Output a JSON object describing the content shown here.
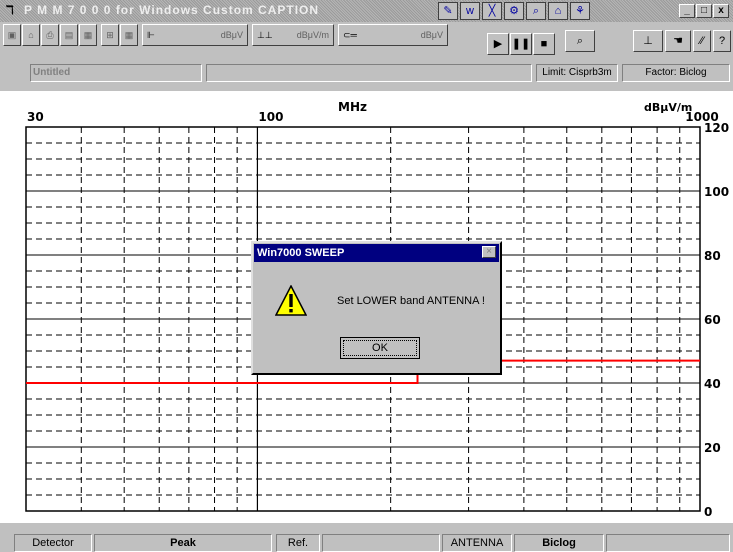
{
  "window": {
    "app_icon": "ℸ",
    "title": "P M M   7 0 0 0  for  Windows  Custom CAPTION",
    "controls": {
      "minimize": "_",
      "maximize": "□",
      "close": "x"
    }
  },
  "toolbar": {
    "units_a": "dBμV",
    "units_b": "dBμV/m",
    "units_c": "dBμV"
  },
  "status_top": {
    "file": "Untitled",
    "limit": "Limit: Cisprb3m",
    "factor": "Factor: Biclog"
  },
  "plot": {
    "x_unit": "MHz",
    "y_unit": "dBμV/m",
    "x_ticks": [
      "30",
      "100",
      "1000"
    ],
    "y_ticks": [
      "120",
      "100",
      "80",
      "60",
      "40",
      "20",
      "0"
    ]
  },
  "chart_data": {
    "type": "line",
    "x_scale": "log",
    "xlim": [
      30,
      1000
    ],
    "ylim": [
      0,
      120
    ],
    "xlabel": "MHz",
    "ylabel": "dBμV/m",
    "grid": true,
    "series": [
      {
        "x": [
          30,
          230,
          230,
          1000
        ],
        "values": [
          40,
          40,
          47,
          47
        ],
        "color": "#ff0000"
      }
    ]
  },
  "dialog": {
    "title": "Win7000 SWEEP",
    "close": "×",
    "message": "Set LOWER band ANTENNA !",
    "ok": "OK"
  },
  "status_bottom": {
    "detector_label": "Detector",
    "detector_value": "Peak",
    "ref_label": "Ref.",
    "antenna_label": "ANTENNA",
    "antenna_value": "Biclog"
  }
}
